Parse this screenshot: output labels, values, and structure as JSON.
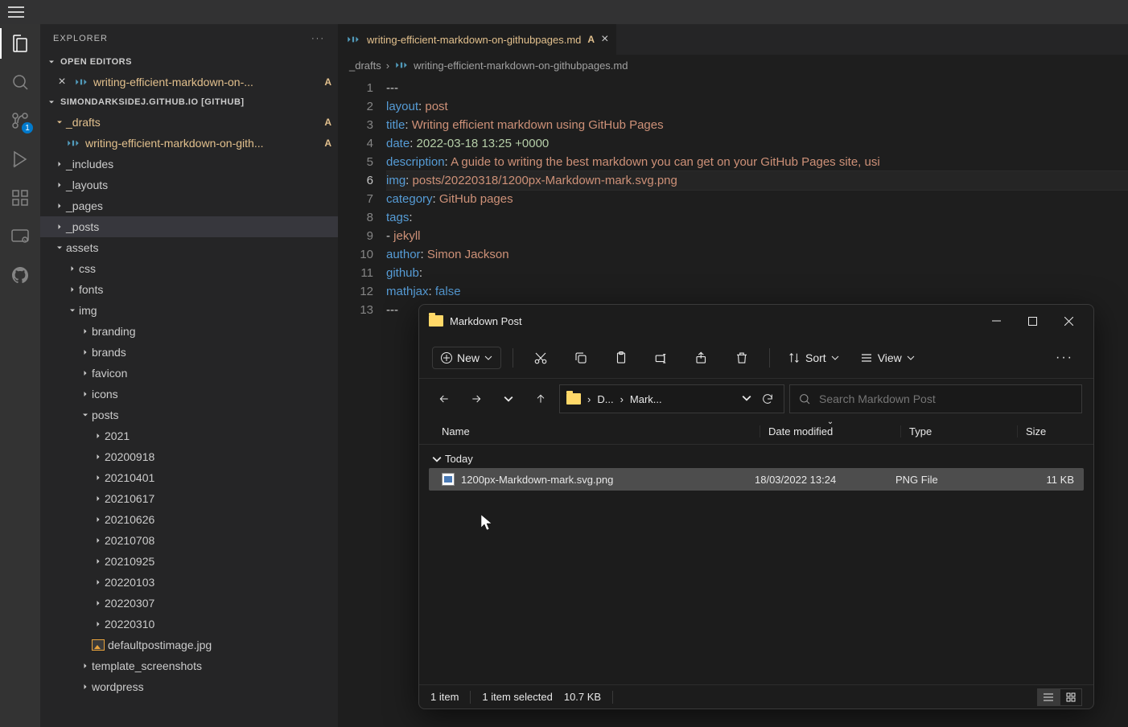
{
  "sidebar": {
    "title": "EXPLORER",
    "openEditorsHeader": "OPEN EDITORS",
    "openEditors": [
      {
        "name": "writing-efficient-markdown-on-...",
        "badge": "A"
      }
    ],
    "rootLabel": "SIMONDARKSIDEJ.GITHUB.IO [GITHUB]",
    "tree": {
      "drafts": {
        "label": "_drafts",
        "badge": "A",
        "file": {
          "name": "writing-efficient-markdown-on-gith...",
          "badge": "A"
        }
      },
      "includes": "_includes",
      "layouts": "_layouts",
      "pages": "_pages",
      "posts": "_posts",
      "assets": {
        "label": "assets",
        "css": "css",
        "fonts": "fonts",
        "img": {
          "label": "img",
          "branding": "branding",
          "brands": "brands",
          "favicon": "favicon",
          "icons": "icons",
          "postsFolder": {
            "label": "posts",
            "items": [
              "2021",
              "20200918",
              "20210401",
              "20210617",
              "20210626",
              "20210708",
              "20210925",
              "20220103",
              "20220307",
              "20220310"
            ],
            "defaultImg": "defaultpostimage.jpg"
          },
          "templateScreenshots": "template_screenshots",
          "wordpress": "wordpress"
        }
      }
    }
  },
  "activity": {
    "scmBadge": "1"
  },
  "tab": {
    "filename": "writing-efficient-markdown-on-githubpages.md",
    "badge": "A"
  },
  "breadcrumb": {
    "folder": "_drafts",
    "file": "writing-efficient-markdown-on-githubpages.md"
  },
  "code": {
    "lines": [
      [
        [
          "dash",
          "---"
        ]
      ],
      [
        [
          "key",
          "layout"
        ],
        [
          "punc",
          ": "
        ],
        [
          "str",
          "post"
        ]
      ],
      [
        [
          "key",
          "title"
        ],
        [
          "punc",
          ": "
        ],
        [
          "str",
          "Writing efficient markdown using GitHub Pages"
        ]
      ],
      [
        [
          "key",
          "date"
        ],
        [
          "punc",
          ": "
        ],
        [
          "date",
          "2022-03-18 13:25 +0000"
        ]
      ],
      [
        [
          "key",
          "description"
        ],
        [
          "punc",
          ": "
        ],
        [
          "str",
          "A guide to writing the best markdown you can get on your GitHub Pages site, usi"
        ]
      ],
      [
        [
          "key",
          "img"
        ],
        [
          "punc",
          ": "
        ],
        [
          "str",
          "posts/20220318/1200px-Markdown-mark.svg.png"
        ]
      ],
      [
        [
          "key",
          "category"
        ],
        [
          "punc",
          ": "
        ],
        [
          "str",
          "GitHub pages"
        ]
      ],
      [
        [
          "key",
          "tags"
        ],
        [
          "punc",
          ":"
        ]
      ],
      [
        [
          "dash",
          "- "
        ],
        [
          "str",
          "jekyll"
        ]
      ],
      [
        [
          "key",
          "author"
        ],
        [
          "punc",
          ": "
        ],
        [
          "str",
          "Simon Jackson"
        ]
      ],
      [
        [
          "key",
          "github"
        ],
        [
          "punc",
          ":"
        ]
      ],
      [
        [
          "key",
          "mathjax"
        ],
        [
          "punc",
          ": "
        ],
        [
          "const",
          "false"
        ]
      ],
      [
        [
          "dash",
          "---"
        ]
      ]
    ],
    "currentLine": 6
  },
  "explorer": {
    "title": "Markdown Post",
    "newLabel": "New",
    "sortLabel": "Sort",
    "viewLabel": "View",
    "address": {
      "seg1": "D...",
      "seg2": "Mark..."
    },
    "searchPlaceholder": "Search Markdown Post",
    "columns": {
      "name": "Name",
      "date": "Date modified",
      "type": "Type",
      "size": "Size"
    },
    "group": "Today",
    "file": {
      "name": "1200px-Markdown-mark.svg.png",
      "date": "18/03/2022 13:24",
      "type": "PNG File",
      "size": "11 KB"
    },
    "status": {
      "count": "1 item",
      "selected": "1 item selected",
      "size": "10.7 KB"
    }
  }
}
